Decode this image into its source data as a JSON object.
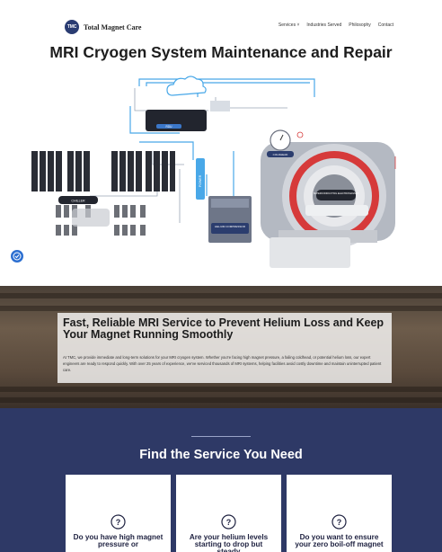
{
  "header": {
    "logo_badge": "TMC",
    "logo_text": "Total Magnet Care",
    "nav": [
      "Services ˅",
      "Industries Served",
      "Philosophy",
      "Contact"
    ]
  },
  "page_title": "MRI Cryogen System Maintenance and Repair",
  "diagram": {
    "labels": {
      "rdu": "RDU",
      "power": "POWER",
      "chiller": "CHILLER",
      "helium_compressor": "HELIUM COMPRESSOR",
      "coldhead": "COLDHEAD",
      "superconducting": "SUPERCONDUCTING ELECTROMAGNET"
    },
    "colors": {
      "pipe_blue": "#49a8e8",
      "magnet_red": "#d63a3a",
      "dark_unit": "#22252e"
    }
  },
  "hero": {
    "heading": "Fast, Reliable MRI Service to Prevent Helium Loss and Keep Your Magnet Running Smoothly",
    "body": "At TMC, we provide immediate and long-term solutions for your MRI cryogen system. Whether you're facing high magnet pressure, a failing coldhead, or potential helium loss, our expert engineers are ready to respond quickly. With over 25 years of experience, we've serviced thousands of MRI systems, helping facilities avoid costly downtime and maintain uninterrupted patient care."
  },
  "services": {
    "title": "Find the Service You Need",
    "cards": [
      {
        "text": "Do you have high magnet pressure or"
      },
      {
        "text": "Are your helium levels starting to drop but steady"
      },
      {
        "text": "Do you want to ensure your zero boil-off magnet"
      }
    ]
  }
}
